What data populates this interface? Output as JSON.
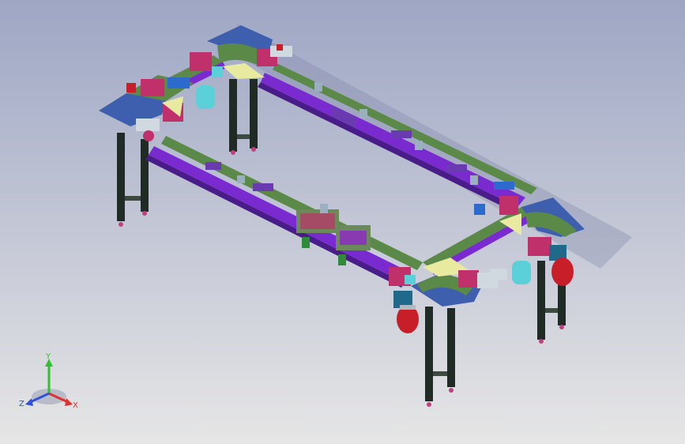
{
  "viewport": {
    "background_top": "#9ea6c4",
    "background_bottom": "#e6e6e6"
  },
  "model": {
    "frame_colors": {
      "purple_rail": "#7a2bd0",
      "green_rail": "#5b8a48",
      "dark_leg": "#1f2b24",
      "corner_plate": "#3e5fae",
      "magenta_block": "#c0306a",
      "red_motor": "#c81e2a",
      "cyan_part": "#5cd0d8",
      "yellow_plate": "#e8eaa0"
    }
  },
  "triad": {
    "x_label": "X",
    "y_label": "Y",
    "z_label": "Z",
    "x_color": "#e03030",
    "y_color": "#30c030",
    "z_color": "#3050e0"
  }
}
